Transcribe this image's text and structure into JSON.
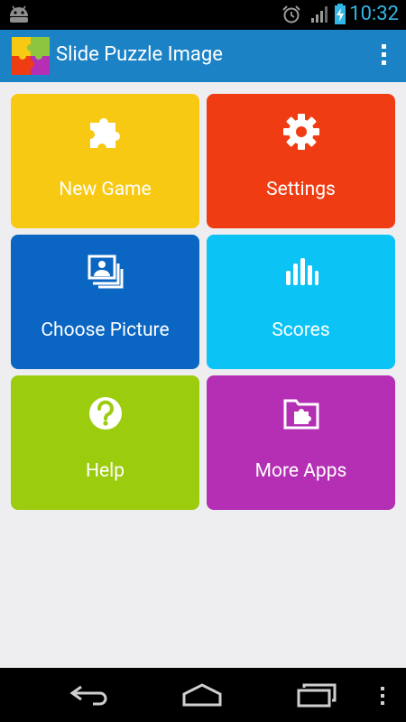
{
  "status_bar": {
    "time": "10:32"
  },
  "action_bar": {
    "title": "Slide Puzzle Image"
  },
  "tiles": [
    {
      "label": "New Game",
      "color": "#f8c913",
      "icon": "puzzle-piece-icon"
    },
    {
      "label": "Settings",
      "color": "#f03c12",
      "icon": "gear-icon"
    },
    {
      "label": "Choose Picture",
      "color": "#0a66c2",
      "icon": "pictures-icon"
    },
    {
      "label": "Scores",
      "color": "#0bc3f5",
      "icon": "bar-chart-icon"
    },
    {
      "label": "Help",
      "color": "#9ccc0e",
      "icon": "help-icon"
    },
    {
      "label": "More Apps",
      "color": "#b42fb4",
      "icon": "folder-puzzle-icon"
    }
  ]
}
